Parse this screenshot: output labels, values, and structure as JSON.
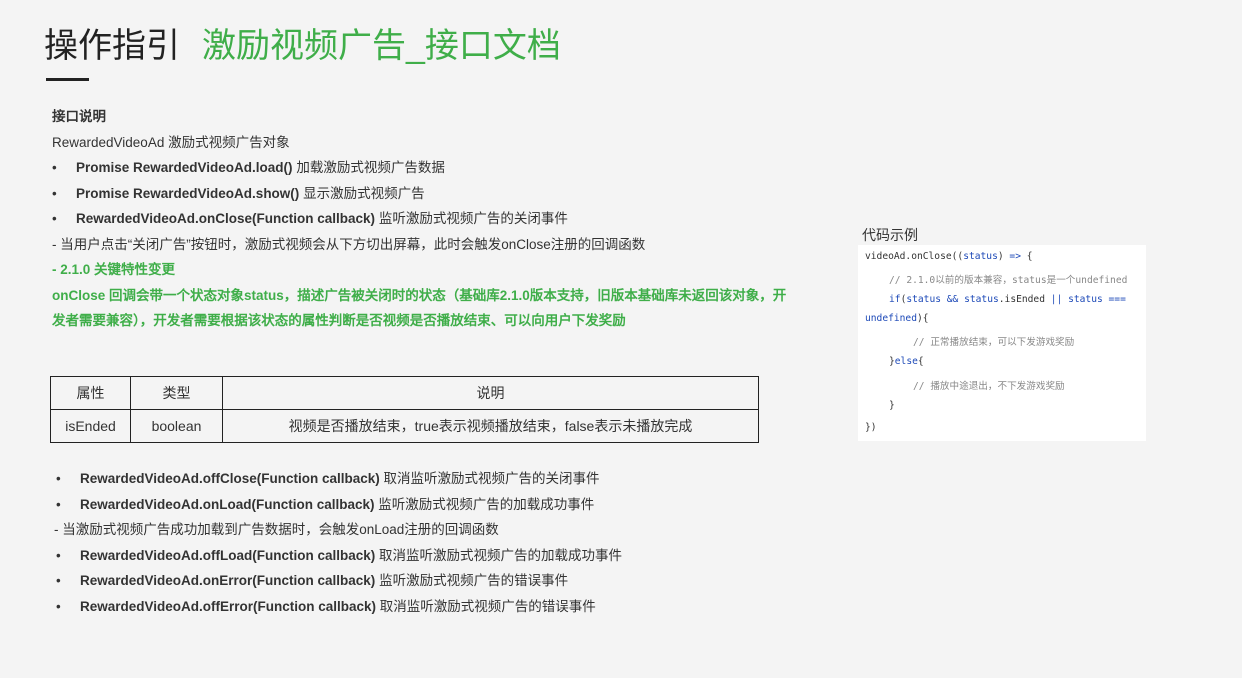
{
  "header": {
    "title_main": "操作指引",
    "title_sub": "激励视频广告_接口文档"
  },
  "intro": {
    "section_label": "接口说明",
    "object_desc": "RewardedVideoAd 激励式视频广告对象",
    "methods": [
      {
        "name": "Promise RewardedVideoAd.load()",
        "desc": " 加载激励式视频广告数据"
      },
      {
        "name": "Promise RewardedVideoAd.show()",
        "desc": " 显示激励式视频广告"
      },
      {
        "name": "RewardedVideoAd.onClose(Function callback)",
        "desc": " 监听激励式视频广告的关闭事件"
      }
    ],
    "note": "- 当用户点击“关闭广告”按钮时，激励式视频会从下方切出屏幕，此时会触发onClose注册的回调函数",
    "version_label": "- 2.1.0 关键特性变更",
    "version_desc_1": "onClose 回调会带一个状态对象status，描述广告被关闭时的状态（基础库2.1.0版本支持，旧版本基础库未返回该对象，开",
    "version_desc_2": "发者需要兼容），开发者需要根据该状态的属性判断是否视频是否播放结束、可以向用户下发奖励"
  },
  "table": {
    "headers": [
      "属性",
      "类型",
      "说明"
    ],
    "rows": [
      [
        "isEnded",
        "boolean",
        "视频是否播放结束，true表示视频播放结束，false表示未播放完成"
      ]
    ]
  },
  "more": {
    "items": [
      {
        "name": "RewardedVideoAd.offClose(Function callback)",
        "desc": " 取消监听激励式视频广告的关闭事件"
      },
      {
        "name": "RewardedVideoAd.onLoad(Function callback)",
        "desc": " 监听激励式视频广告的加载成功事件"
      }
    ],
    "onload_note": "- 当激励式视频广告成功加载到广告数据时，会触发onLoad注册的回调函数",
    "items2": [
      {
        "name": "RewardedVideoAd.offLoad(Function callback)",
        "desc": " 取消监听激励式视频广告的加载成功事件"
      },
      {
        "name": "RewardedVideoAd.onError(Function callback)",
        "desc": " 监听激励式视频广告的错误事件"
      },
      {
        "name": "RewardedVideoAd.offError(Function callback)",
        "desc": " 取消监听激励式视频广告的错误事件"
      }
    ]
  },
  "code": {
    "caption": "代码示例",
    "l1a": "videoAd.onClose((",
    "l1b": "status",
    "l1c": ") ",
    "l1d": "=>",
    "l1e": " {",
    "l2": "// 2.1.0以前的版本兼容，status是一个undefined",
    "l3a": "if",
    "l3b": "(",
    "l3c": "status",
    "l3d": " && ",
    "l3e": "status",
    "l3f": ".isEnded ",
    "l3g": "||",
    "l3h": " status ===",
    "l4a": "undefined",
    "l4b": "){",
    "l5": "// 正常播放结束，可以下发游戏奖励",
    "l6a": "}",
    "l6b": "else",
    "l6c": "{",
    "l7": "// 播放中途退出，不下发游戏奖励",
    "l8": "}",
    "l9": "})"
  }
}
